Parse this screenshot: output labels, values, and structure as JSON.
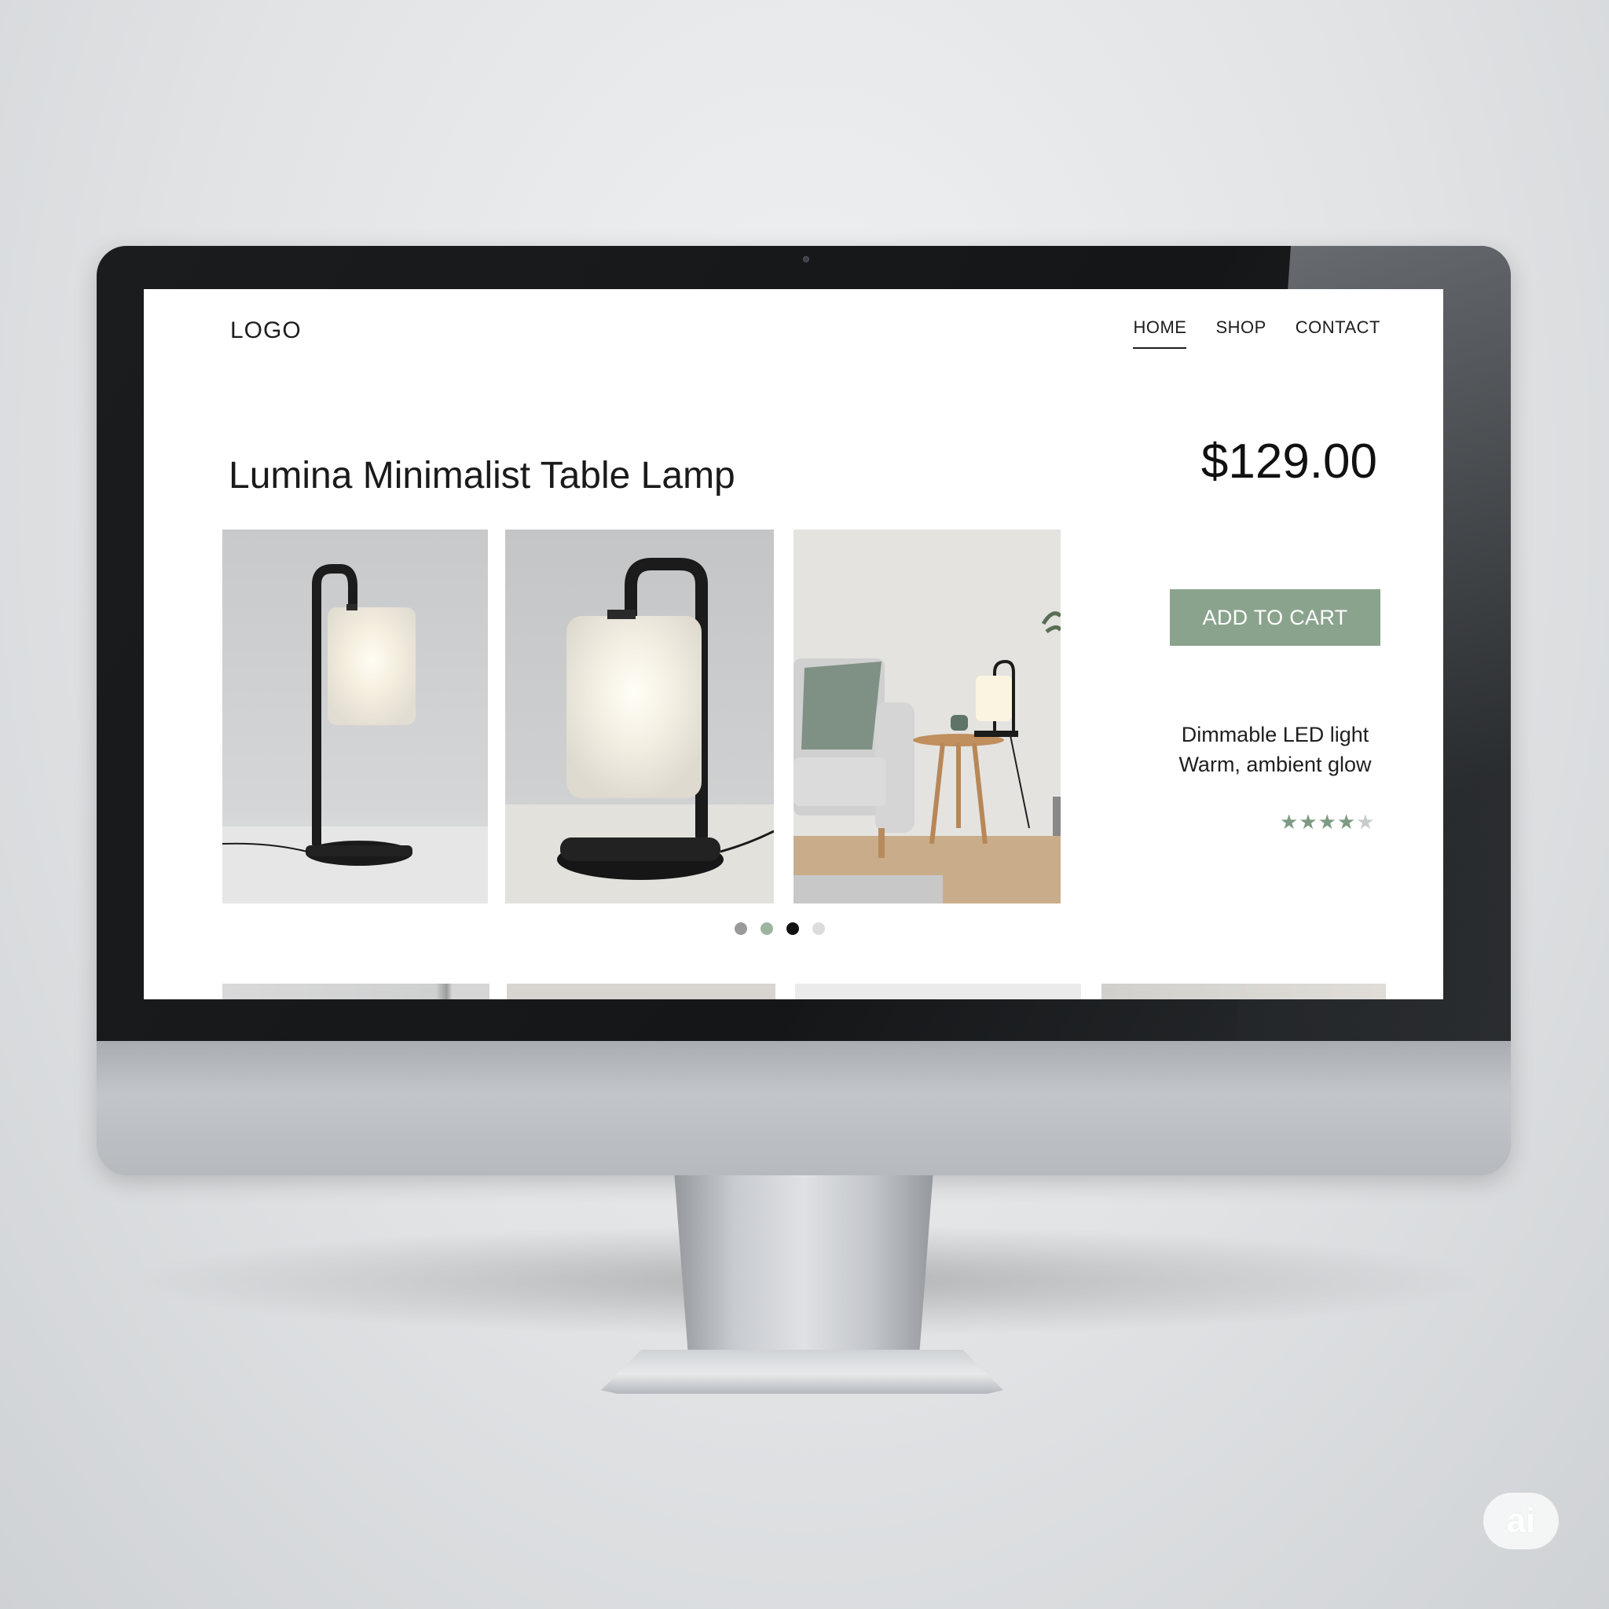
{
  "nav": {
    "logo": "LOGO",
    "links": [
      "HOME",
      "SHOP",
      "CONTACT"
    ],
    "active": "HOME"
  },
  "product": {
    "title": "Lumina Minimalist Table Lamp",
    "price": "$129.00",
    "cta_label": "ADD TO CART",
    "features": [
      "Dimmable LED light",
      "Warm, ambient glow"
    ],
    "rating": {
      "value": 4,
      "max": 5
    }
  },
  "gallery": {
    "slide_count": 4,
    "active_slide": 3,
    "dot_colors": [
      "#9a9a9a",
      "#9db5a0",
      "#111111",
      "#dcdcdc"
    ]
  },
  "badge": {
    "label": "ai"
  },
  "colors": {
    "accent": "#8aa38d",
    "star_filled": "#7f9a84",
    "star_empty": "#c6cdc7"
  },
  "icons": [
    "star-icon"
  ]
}
